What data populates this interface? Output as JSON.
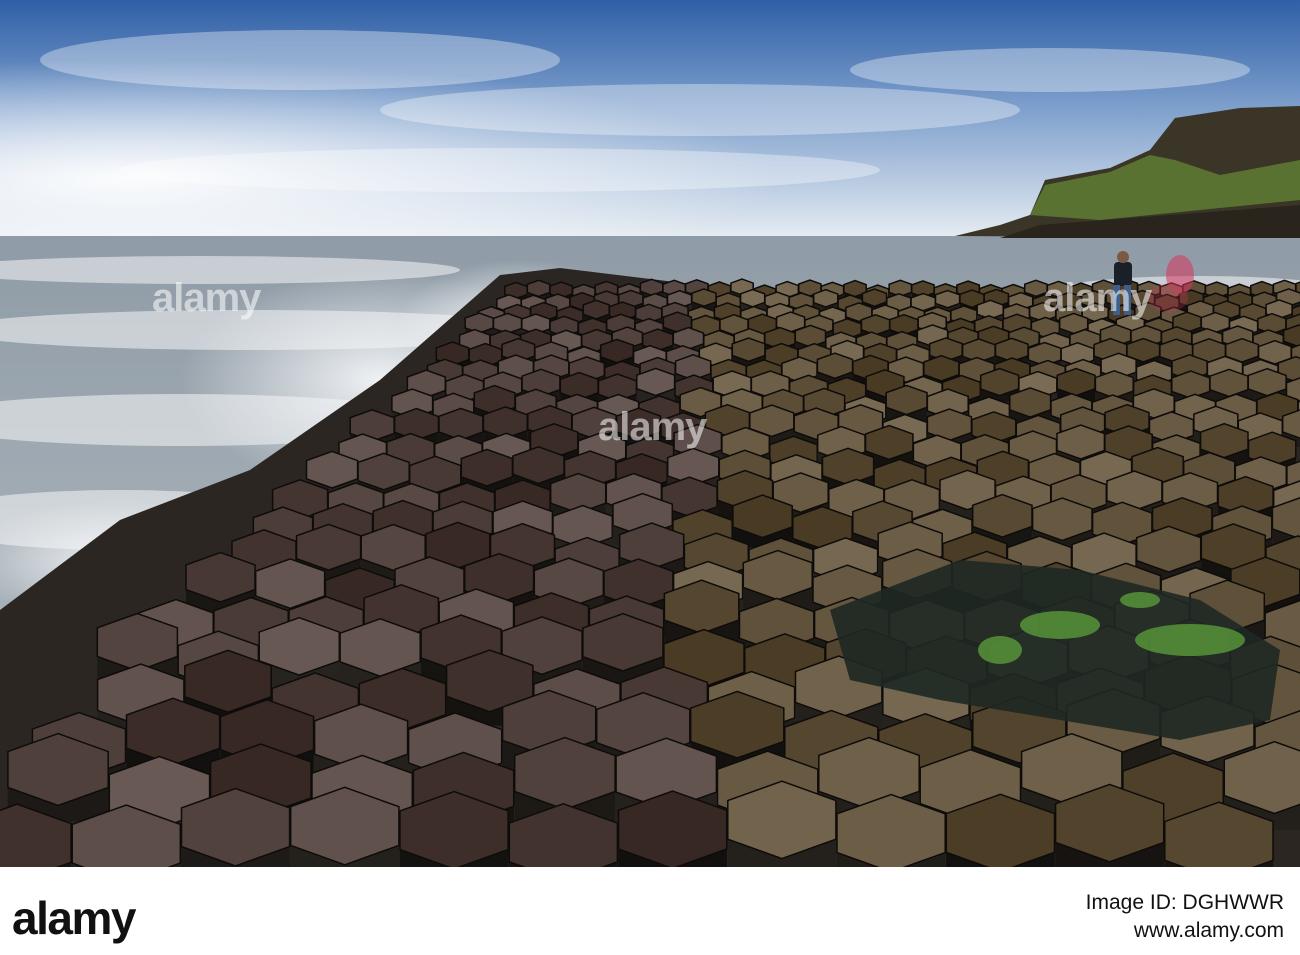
{
  "watermark": {
    "text": "alamy"
  },
  "footer": {
    "logo": "alamy",
    "image_id_label": "Image ID: DGHWWR",
    "site": "www.alamy.com"
  },
  "colors": {
    "sky_top": "#3b6bb0",
    "sea": "#8a97a3",
    "basalt": "#2a2623",
    "cliff": "#3f3a2c",
    "grass": "#6b8a38"
  }
}
